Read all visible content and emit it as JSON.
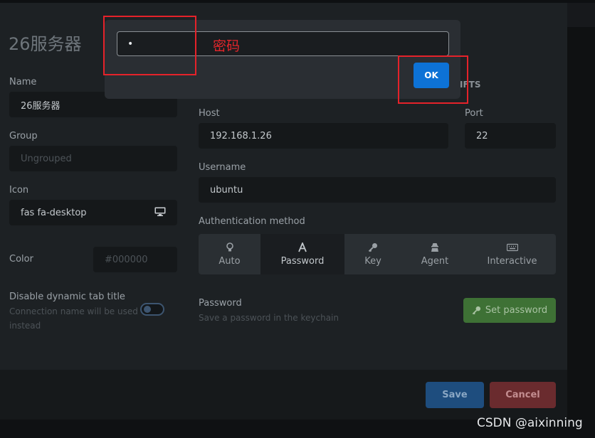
{
  "page_title": "26服务器",
  "left_form": {
    "name": {
      "label": "Name",
      "value": "26服务器"
    },
    "group": {
      "label": "Group",
      "placeholder": "Ungrouped"
    },
    "icon": {
      "label": "Icon",
      "value": "fas fa-desktop",
      "icon": "desktop-icon"
    },
    "color": {
      "label": "Color",
      "placeholder": "#000000"
    },
    "dynamic_title": {
      "label": "Disable dynamic tab title",
      "hint_line1": "Connection name will be used",
      "hint_line2": "instead",
      "enabled": false
    }
  },
  "connection": {
    "section_fragment": "IFTS",
    "host": {
      "label": "Host",
      "value": "192.168.1.26"
    },
    "port": {
      "label": "Port",
      "value": "22"
    },
    "username": {
      "label": "Username",
      "value": "ubuntu"
    },
    "auth": {
      "label": "Authentication method",
      "selected": "Password",
      "options": [
        {
          "label": "Auto",
          "icon": "lightbulb-icon"
        },
        {
          "label": "Password",
          "icon": "font-a-icon"
        },
        {
          "label": "Key",
          "icon": "key-icon"
        },
        {
          "label": "Agent",
          "icon": "user-secret-icon"
        },
        {
          "label": "Interactive",
          "icon": "keyboard-icon"
        }
      ]
    },
    "password": {
      "label": "Password",
      "hint": "Save a password in the keychain",
      "button_label": "Set password",
      "button_icon": "key-icon"
    }
  },
  "footer": {
    "save_label": "Save",
    "cancel_label": "Cancel"
  },
  "dialog": {
    "input_value": "•",
    "ok_label": "OK"
  },
  "annotation": {
    "text": "密码"
  },
  "watermark": "CSDN @aixinning",
  "colors": {
    "ok_button": "#0d72d6",
    "save_button": "#1e4d7e",
    "cancel_button": "#6a2b2e",
    "set_password_button": "#3e7135",
    "annotation_red": "#e5222a"
  }
}
